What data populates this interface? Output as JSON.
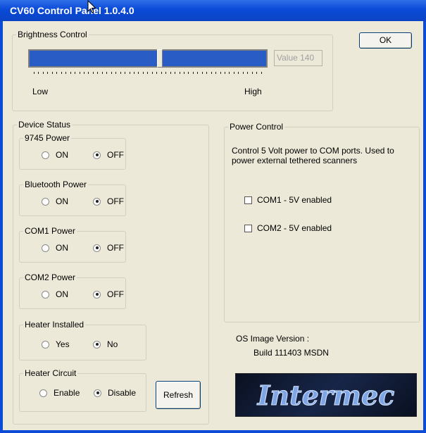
{
  "window": {
    "title": "CV60 Control Panel 1.0.4.0"
  },
  "ok_label": "OK",
  "brightness": {
    "legend": "Brightness Control",
    "value_text": "Value 140",
    "value": 140,
    "range": [
      0,
      255
    ],
    "low_label": "Low",
    "high_label": "High"
  },
  "device_status": {
    "legend": "Device Status",
    "groups": [
      {
        "legend": "9745 Power",
        "options": [
          "ON",
          "OFF"
        ],
        "selected": 1
      },
      {
        "legend": "Bluetooth Power",
        "options": [
          "ON",
          "OFF"
        ],
        "selected": 1
      },
      {
        "legend": "COM1 Power",
        "options": [
          "ON",
          "OFF"
        ],
        "selected": 1
      },
      {
        "legend": "COM2 Power",
        "options": [
          "ON",
          "OFF"
        ],
        "selected": 1
      },
      {
        "legend": "Heater Installed",
        "options": [
          "Yes",
          "No"
        ],
        "selected": 1
      },
      {
        "legend": "Heater Circuit",
        "options": [
          "Enable",
          "Disable"
        ],
        "selected": 1
      }
    ],
    "refresh_label": "Refresh"
  },
  "power_control": {
    "legend": "Power Control",
    "description_line1": "Control 5 Volt power to COM ports. Used to",
    "description_line2": "power external tethered scanners",
    "com1_label": "COM1 - 5V enabled",
    "com1_checked": false,
    "com2_label": "COM2 - 5V enabled",
    "com2_checked": false
  },
  "os_image": {
    "label": "OS Image Version :",
    "build": "Build 111403 MSDN"
  },
  "logo": {
    "text": "Intermec"
  },
  "colors": {
    "titlebar": "#0b4bd6",
    "dialog_bg": "#ece9d8",
    "slider_fill": "#2a5cc6",
    "logo_text": "#6f9be0"
  }
}
